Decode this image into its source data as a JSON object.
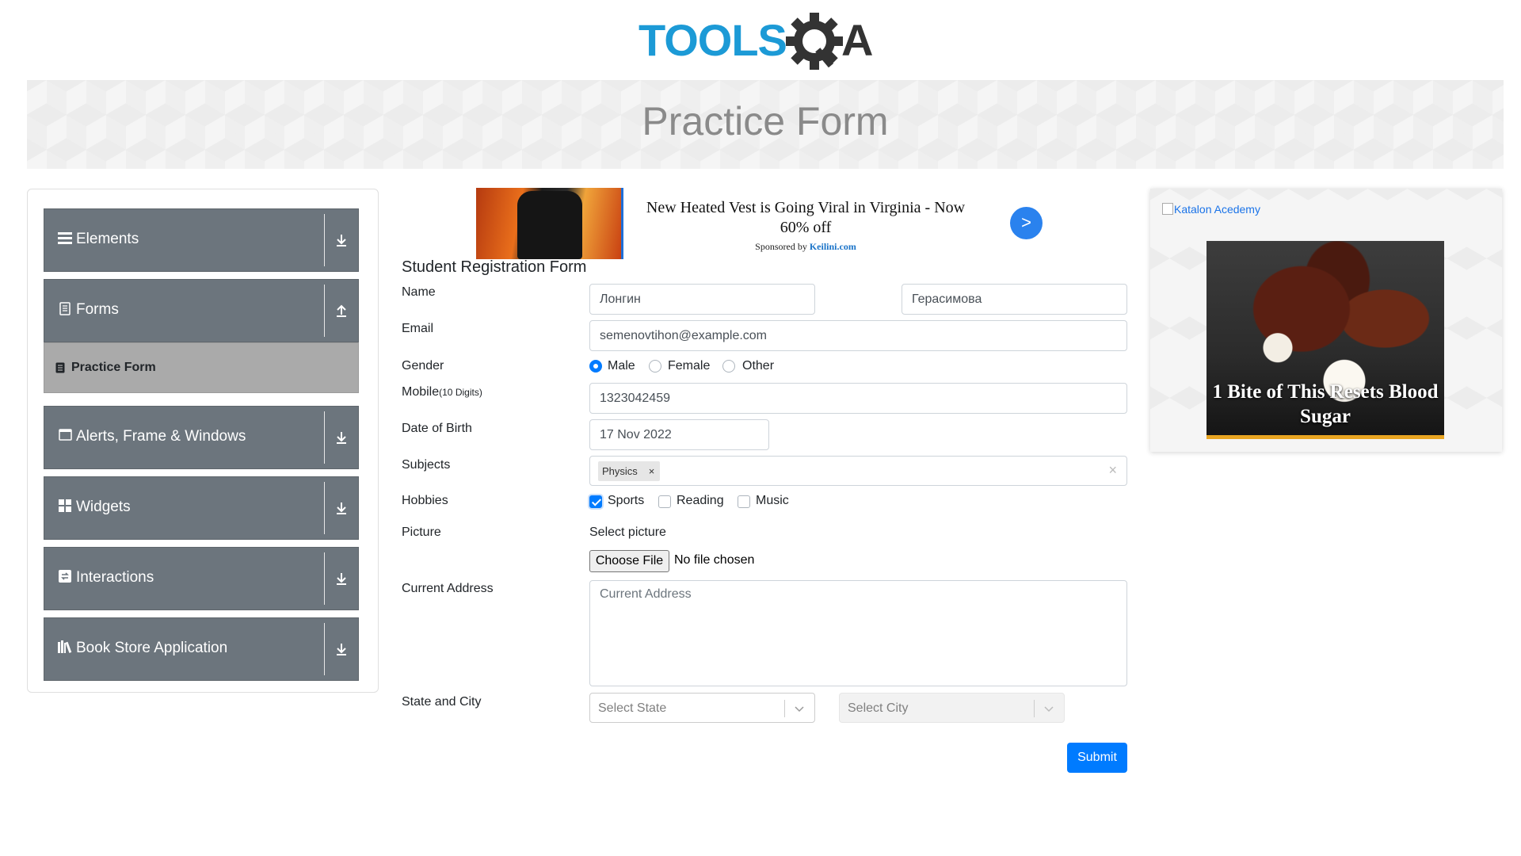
{
  "logo": {
    "text_tools": "TOOLS",
    "text_qa": "QA",
    "color_primary": "#1c9ad6",
    "color_gear": "#333333"
  },
  "banner": {
    "title": "Practice Form"
  },
  "sidebar": {
    "groups": [
      {
        "label": "Elements",
        "icon": "menu-icon",
        "arrow": "download-arrow-icon"
      },
      {
        "label": "Forms",
        "icon": "document-icon",
        "arrow": "upload-arrow-icon",
        "items": [
          {
            "label": "Practice Form",
            "icon": "list-icon",
            "active": true
          }
        ]
      },
      {
        "label": "Alerts, Frame & Windows",
        "icon": "window-icon",
        "arrow": "download-arrow-icon"
      },
      {
        "label": "Widgets",
        "icon": "grid-icon",
        "arrow": "download-arrow-icon"
      },
      {
        "label": "Interactions",
        "icon": "interaction-icon",
        "arrow": "download-arrow-icon"
      },
      {
        "label": "Book Store Application",
        "icon": "books-icon",
        "arrow": "download-arrow-icon"
      }
    ]
  },
  "ad_top": {
    "headline": "New Heated Vest is Going Viral in Virginia - Now 60% off",
    "sponsor_prefix": "Sponsored by",
    "sponsor_name": "Keilini.com",
    "go_label": ">"
  },
  "form": {
    "title": "Student Registration Form",
    "name_label": "Name",
    "first_name": "Лонгин",
    "last_name": "Герасимова",
    "email_label": "Email",
    "email": "semenovtihon@example.com",
    "gender_label": "Gender",
    "gender_options": [
      "Male",
      "Female",
      "Other"
    ],
    "gender_selected": "Male",
    "mobile_label": "Mobile",
    "mobile_hint": "(10 Digits)",
    "mobile": "1323042459",
    "dob_label": "Date of Birth",
    "dob": "17 Nov 2022",
    "subjects_label": "Subjects",
    "subjects": [
      "Physics"
    ],
    "subject_remove": "×",
    "subjects_clear": "×",
    "hobbies_label": "Hobbies",
    "hobbies": [
      {
        "label": "Sports",
        "checked": true
      },
      {
        "label": "Reading",
        "checked": false
      },
      {
        "label": "Music",
        "checked": false
      }
    ],
    "picture_label": "Picture",
    "picture_prompt": "Select picture",
    "file_button": "Choose File",
    "file_status": "No file chosen",
    "address_label": "Current Address",
    "address_placeholder": "Current Address",
    "state_city_label": "State and City",
    "state_placeholder": "Select State",
    "city_placeholder": "Select City",
    "submit": "Submit"
  },
  "ad_right": {
    "alt_text": "Katalon Acedemy",
    "headline": "1 Bite of This Resets Blood Sugar"
  },
  "colors": {
    "accent": "#007bff",
    "sidebar": "#6c757d",
    "sidebar_active": "#aaaaaa"
  }
}
